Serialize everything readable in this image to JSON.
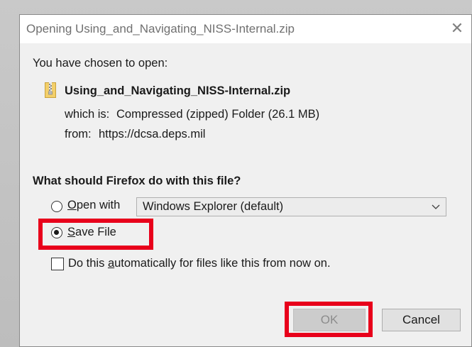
{
  "dialog": {
    "title": "Opening Using_and_Navigating_NISS-Internal.zip",
    "close_glyph": "✕"
  },
  "intro": "You have chosen to open:",
  "file": {
    "name": "Using_and_Navigating_NISS-Internal.zip",
    "which_is_label": "which is:",
    "type": "Compressed (zipped) Folder (26.1 MB)",
    "from_label": "from:",
    "source": "https://dcsa.deps.mil",
    "icon": "zip-folder-icon"
  },
  "question": "What should Firefox do with this file?",
  "options": {
    "open_with": {
      "label_underlined": "O",
      "label_rest": "pen with",
      "selected": false,
      "app": "Windows Explorer (default)"
    },
    "save_file": {
      "label_underlined": "S",
      "label_rest": "ave File",
      "selected": true
    },
    "auto": {
      "label_prefix": "Do this ",
      "label_underlined": "a",
      "label_rest": "utomatically for files like this from now on.",
      "checked": false
    }
  },
  "buttons": {
    "ok": "OK",
    "cancel": "Cancel"
  },
  "colors": {
    "highlight": "#e8001b",
    "dialog_bg": "#f0f0f0"
  }
}
